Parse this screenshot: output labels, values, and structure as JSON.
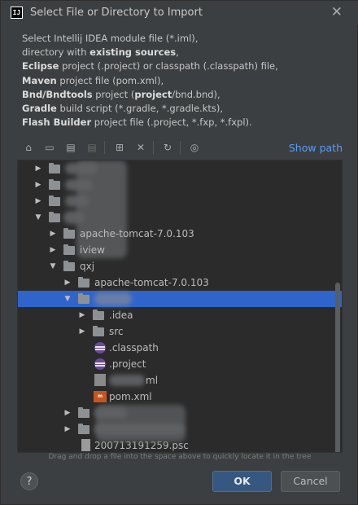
{
  "dialog": {
    "title": "Select File or Directory to Import",
    "app_icon": "IJ",
    "close_glyph": "✕"
  },
  "description": {
    "line1": "Select Intellij IDEA module file (*.iml),",
    "line2_pre": "directory with ",
    "line2_bold": "existing sources",
    "line2_post": ",",
    "line3_bold": "Eclipse",
    "line3_post": " project (.project) or classpath (.classpath) file,",
    "line4_bold": "Maven",
    "line4_post": " project file (pom.xml),",
    "line5_bold": "Bnd/Bndtools",
    "line5_mid": " project (",
    "line5_bold2": "project",
    "line5_post": "/bnd.bnd),",
    "line6_bold": "Gradle",
    "line6_post": " build script (*.gradle, *.gradle.kts),",
    "line7_bold": "Flash Builder",
    "line7_post": " project file (.project, *.fxp, *.fxpl)."
  },
  "toolbar": {
    "show_path_label": "Show path"
  },
  "tree": {
    "rows": [
      {
        "label": "apache-tomcat-7.0.103"
      },
      {
        "label": "iview"
      },
      {
        "label": "qxj"
      },
      {
        "label": "apache-tomcat-7.0.103"
      },
      {
        "label": ".idea"
      },
      {
        "label": "src"
      },
      {
        "label": ".classpath"
      },
      {
        "label": ".project"
      },
      {
        "label": "ml"
      },
      {
        "label": "pom.xml"
      },
      {
        "label": "20071319125­9.psc"
      }
    ]
  },
  "hint": "Drag and drop a file into the space above to quickly locate it in the tree",
  "buttons": {
    "help": "?",
    "ok": "OK",
    "cancel": "Cancel"
  },
  "colors": {
    "accent": "#589df6",
    "selection": "#2f65ca",
    "ok_button": "#365880"
  }
}
